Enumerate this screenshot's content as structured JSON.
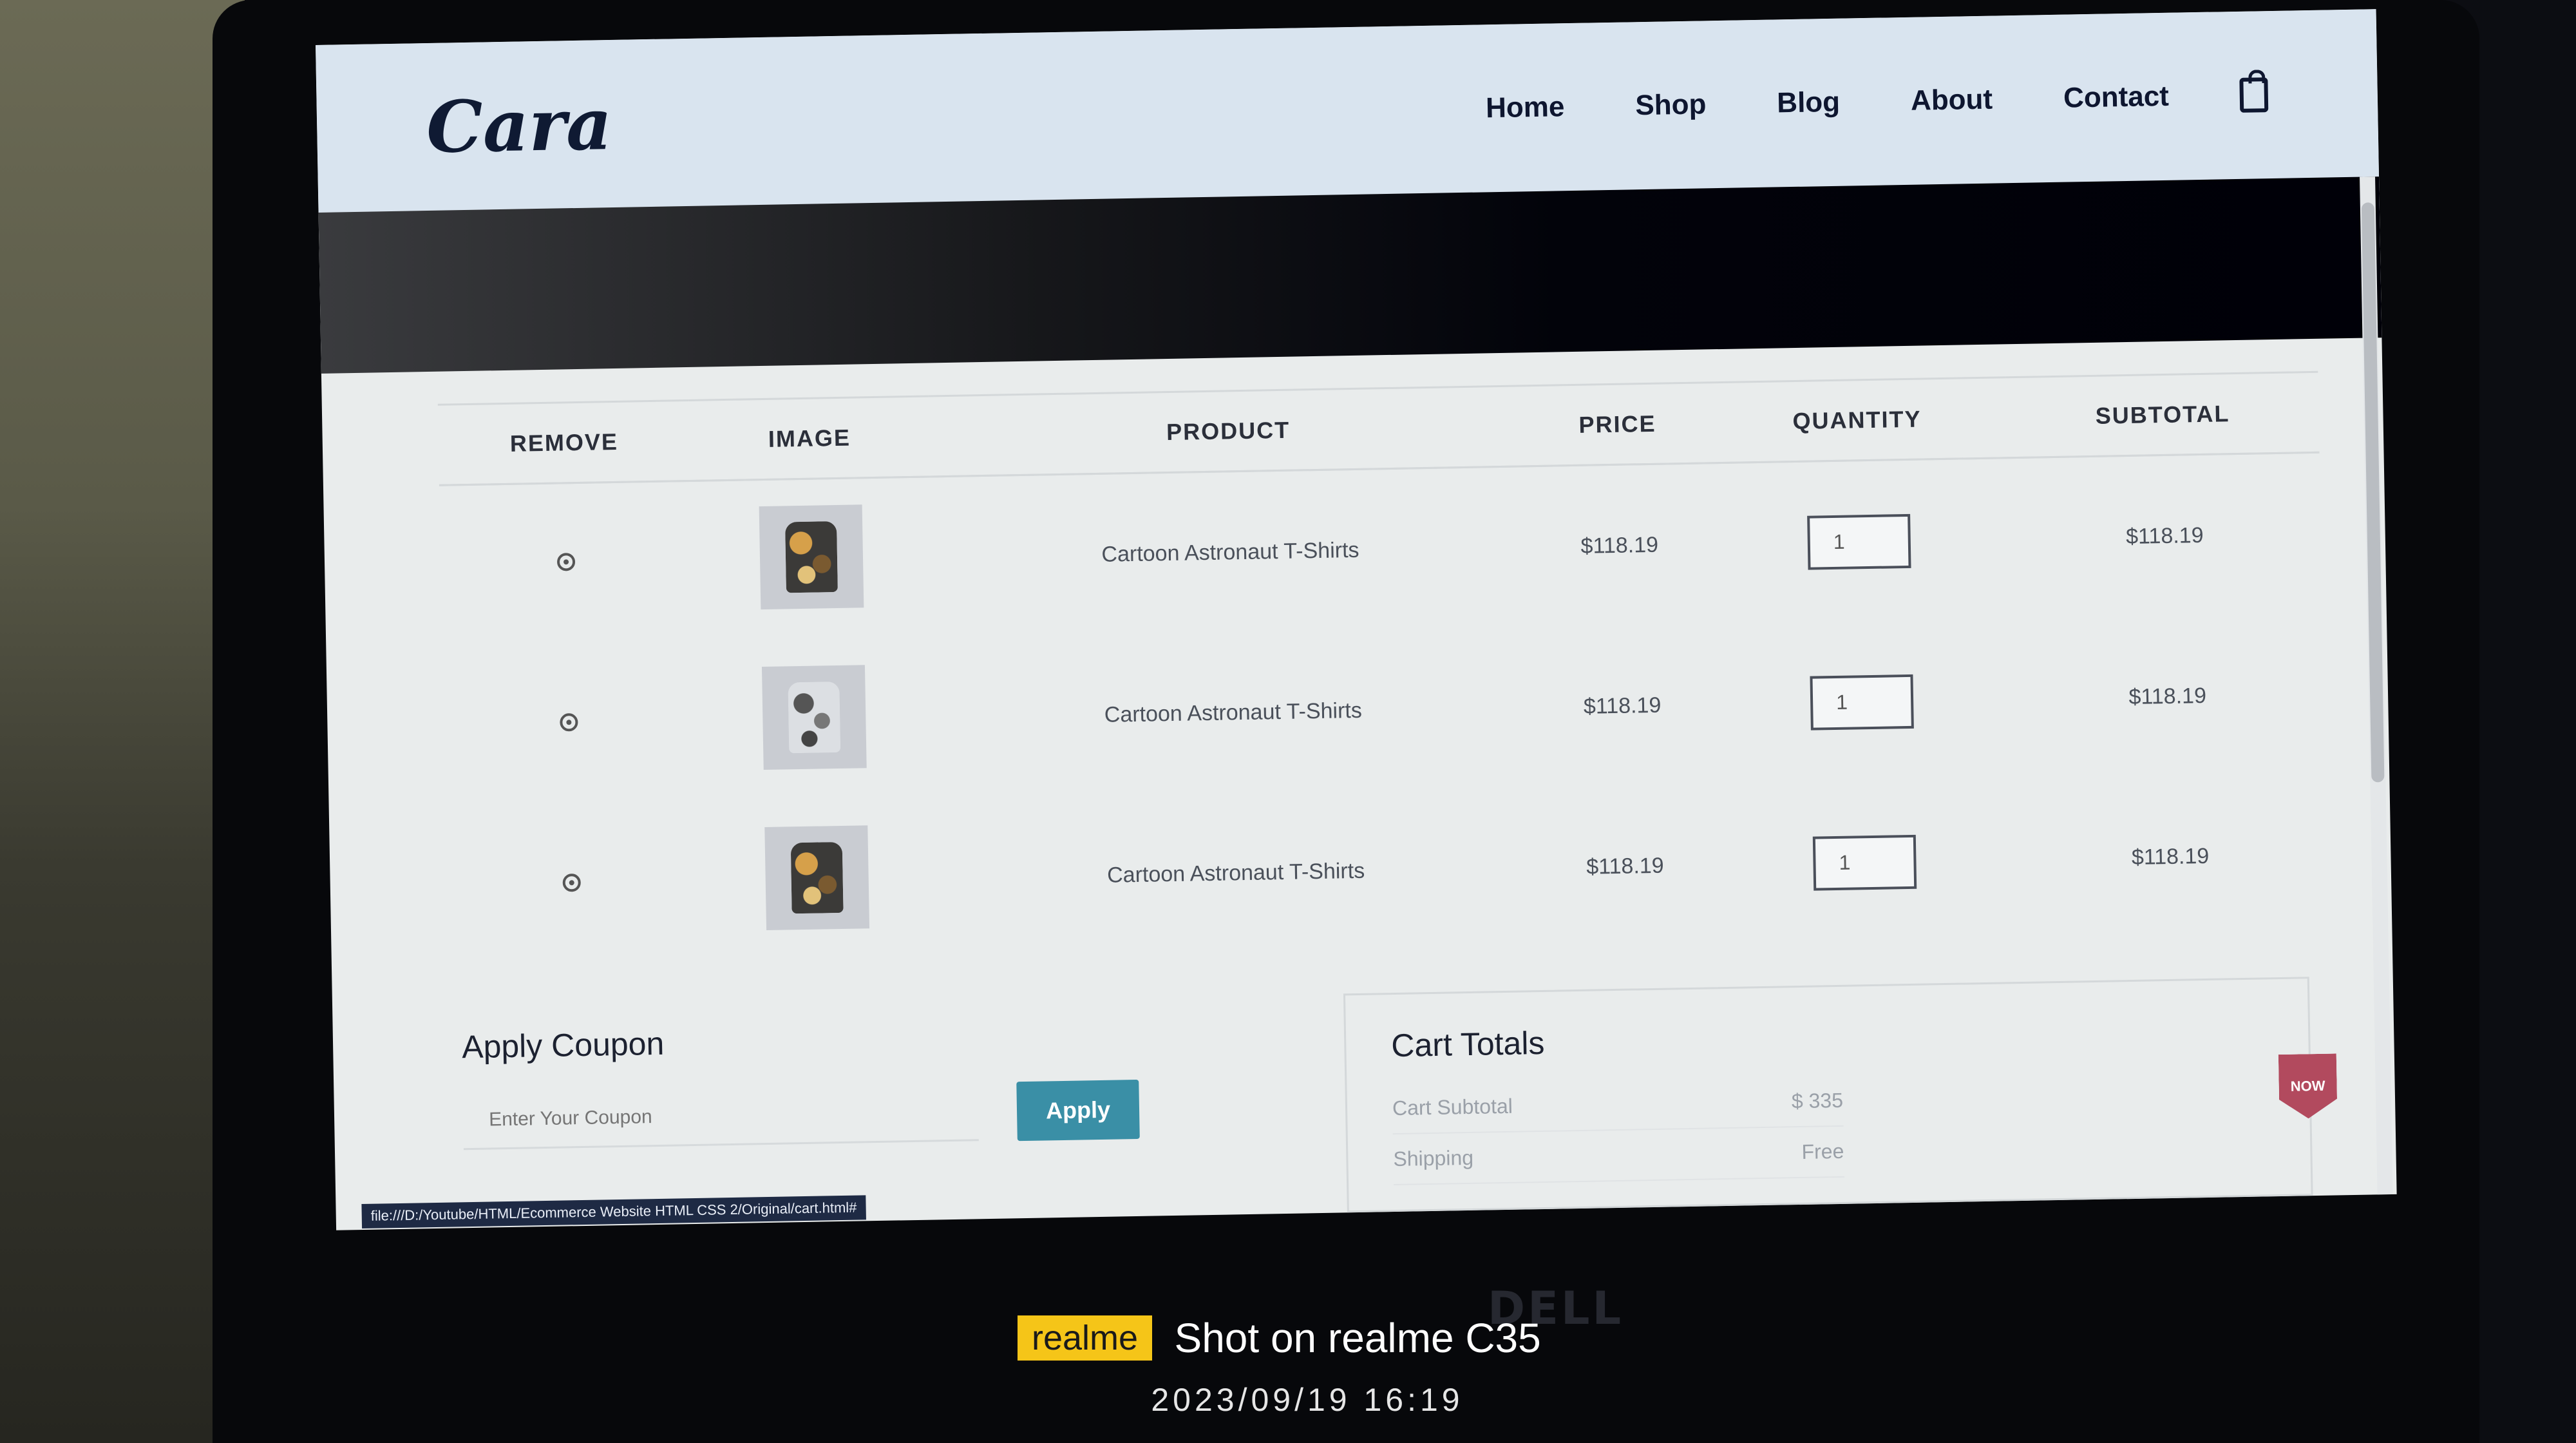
{
  "site": {
    "logo": "Cara",
    "nav": [
      "Home",
      "Shop",
      "Blog",
      "About",
      "Contact"
    ]
  },
  "cart": {
    "headers": [
      "REMOVE",
      "IMAGE",
      "PRODUCT",
      "PRICE",
      "QUANTITY",
      "SUBTOTAL"
    ],
    "rows": [
      {
        "product": "Cartoon Astronaut T-Shirts",
        "price": "$118.19",
        "quantity": "1",
        "subtotal": "$118.19"
      },
      {
        "product": "Cartoon Astronaut T-Shirts",
        "price": "$118.19",
        "quantity": "1",
        "subtotal": "$118.19"
      },
      {
        "product": "Cartoon Astronaut T-Shirts",
        "price": "$118.19",
        "quantity": "1",
        "subtotal": "$118.19"
      }
    ]
  },
  "coupon": {
    "title": "Apply Coupon",
    "placeholder": "Enter Your Coupon",
    "button": "Apply"
  },
  "totals": {
    "title": "Cart Totals",
    "subtotal_label": "Cart Subtotal",
    "subtotal_value": "$ 335",
    "shipping_label": "Shipping",
    "shipping_value": "Free"
  },
  "badge": "NOW",
  "status_url": "file:///D:/Youtube/HTML/Ecommerce Website HTML CSS 2/Original/cart.html#",
  "device": {
    "logo": "DELL"
  },
  "watermark": {
    "brand": "realme",
    "shot": "Shot on realme C35",
    "datetime": "2023/09/19  16:19"
  }
}
